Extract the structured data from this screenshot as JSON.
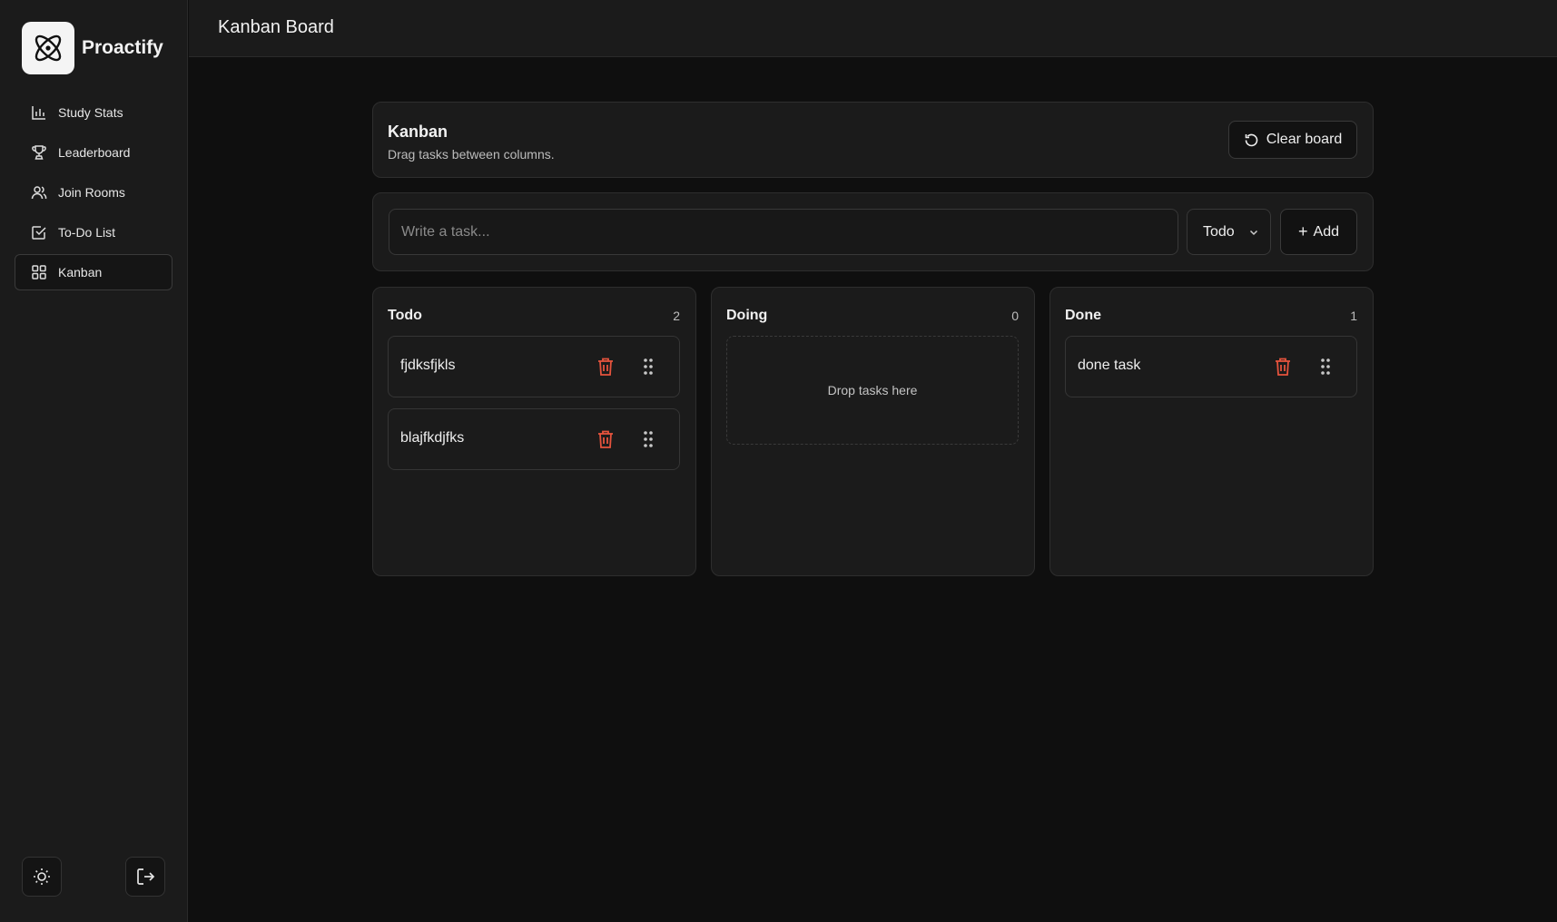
{
  "app": {
    "name": "Proactify"
  },
  "sidebar": {
    "items": [
      {
        "label": "Study Stats",
        "icon": "bar-chart-icon",
        "active": false
      },
      {
        "label": "Leaderboard",
        "icon": "trophy-icon",
        "active": false
      },
      {
        "label": "Join Rooms",
        "icon": "users-icon",
        "active": false
      },
      {
        "label": "To-Do List",
        "icon": "check-square-icon",
        "active": false
      },
      {
        "label": "Kanban",
        "icon": "grid-icon",
        "active": true
      }
    ],
    "footer": {
      "theme_icon": "sun-icon",
      "logout_icon": "logout-icon"
    }
  },
  "header": {
    "title": "Kanban Board"
  },
  "board": {
    "title": "Kanban",
    "subtitle": "Drag tasks between columns.",
    "clear_label": "Clear board"
  },
  "form": {
    "placeholder": "Write a task...",
    "value": "",
    "column_select": "Todo",
    "add_label": "Add"
  },
  "columns": [
    {
      "title": "Todo",
      "count": "2",
      "tasks": [
        "fjdksfjkls",
        "blajfkdjfks"
      ]
    },
    {
      "title": "Doing",
      "count": "0",
      "tasks": [],
      "empty_text": "Drop tasks here"
    },
    {
      "title": "Done",
      "count": "1",
      "tasks": [
        "done task"
      ]
    }
  ],
  "colors": {
    "background": "#0f0f0f",
    "panel": "#1b1b1b",
    "delete": "#e5533d"
  }
}
